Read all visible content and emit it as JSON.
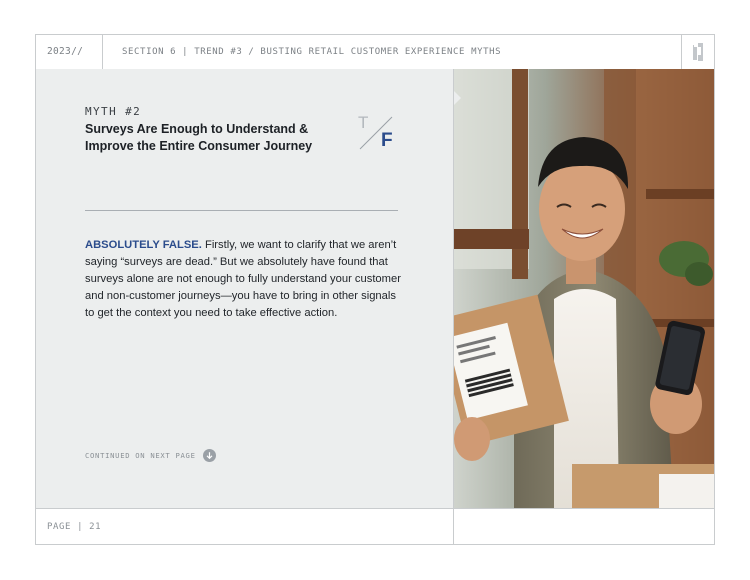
{
  "header": {
    "year": "2023//",
    "section": "SECTION 6 | TREND #3 / BUSTING RETAIL CUSTOMER EXPERIENCE MYTHS",
    "logo_icon": "brand-logo-icon"
  },
  "myth": {
    "label": "MYTH #2",
    "title": "Surveys Are Enough to Understand & Improve the Entire Consumer Journey",
    "true_letter": "T",
    "false_letter": "F",
    "verdict": "ABSOLUTELY FALSE.",
    "body": " Firstly, we want to clarify that we aren’t saying “surveys are dead.” But we absolutely have found that surveys alone are not enough to fully understand your customer and non-customer journeys—you have to bring in other signals to get the context you need to take effective action."
  },
  "continued": {
    "label": "CONTINUED ON NEXT PAGE",
    "icon": "arrow-down-circle-icon"
  },
  "photo": {
    "subject": "man-holding-package-and-phone"
  },
  "footer": {
    "page": "PAGE | 21"
  },
  "colors": {
    "accent": "#2b4c8c",
    "panel": "#eceeee",
    "border": "#c9ccce"
  }
}
